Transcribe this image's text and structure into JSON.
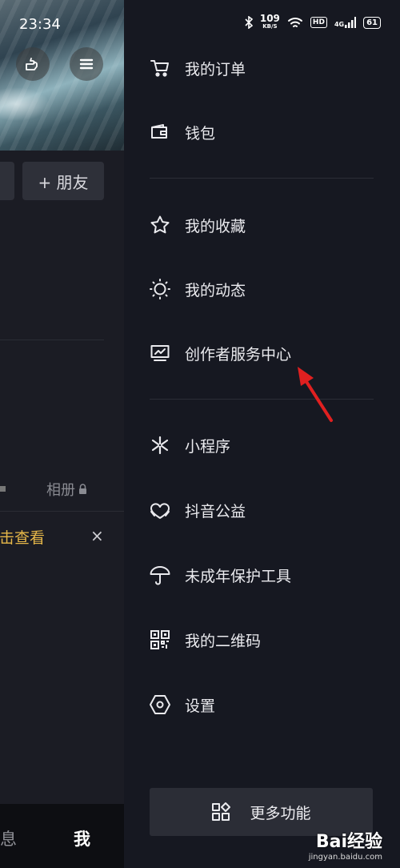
{
  "status_bar": {
    "time": "23:34",
    "net_speed_value": "109",
    "net_speed_unit": "KB/S",
    "hd_badge": "HD",
    "network_type": "4G",
    "battery": "61"
  },
  "background_page": {
    "add_friend_label": "+ 朋友",
    "album_label": "相册",
    "tip_text": "点击查看",
    "close_symbol": "×",
    "bottom_tabs": [
      "息",
      "我"
    ]
  },
  "drawer": {
    "menu_group_1": [
      {
        "label": "我的订单",
        "icon": "cart-icon"
      },
      {
        "label": "钱包",
        "icon": "wallet-icon"
      }
    ],
    "menu_group_2": [
      {
        "label": "我的收藏",
        "icon": "star-icon"
      },
      {
        "label": "我的动态",
        "icon": "sun-icon"
      },
      {
        "label": "创作者服务中心",
        "icon": "monitor-chart-icon"
      }
    ],
    "menu_group_3": [
      {
        "label": "小程序",
        "icon": "mini-program-icon"
      },
      {
        "label": "抖音公益",
        "icon": "heart-hands-icon"
      },
      {
        "label": "未成年保护工具",
        "icon": "umbrella-icon"
      },
      {
        "label": "我的二维码",
        "icon": "qr-code-icon"
      },
      {
        "label": "设置",
        "icon": "settings-hexagon-icon"
      }
    ],
    "more_button_label": "更多功能"
  },
  "annotation": {
    "arrow_color": "#e02020"
  },
  "watermark": {
    "brand": "Bai经验",
    "url": "jingyan.baidu.com"
  }
}
